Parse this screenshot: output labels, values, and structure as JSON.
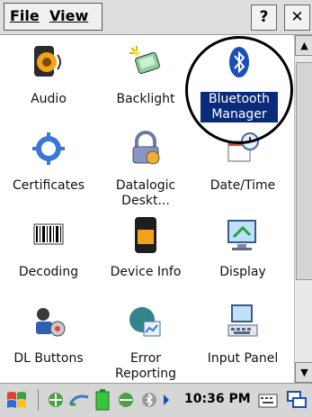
{
  "menubar": {
    "file_label": "File",
    "view_label": "View",
    "help_label": "?",
    "close_label": "✕"
  },
  "icons": [
    {
      "label": "Audio",
      "icon": "speaker-icon"
    },
    {
      "label": "Backlight",
      "icon": "backlight-icon"
    },
    {
      "label": "Bluetooth Manager",
      "icon": "bluetooth-icon",
      "selected": true
    },
    {
      "label": "Certificates",
      "icon": "certificate-icon"
    },
    {
      "label": "Datalogic Deskt...",
      "icon": "datalogic-desktop-icon"
    },
    {
      "label": "Date/Time",
      "icon": "calendar-clock-icon"
    },
    {
      "label": "Decoding",
      "icon": "barcode-icon"
    },
    {
      "label": "Device Info",
      "icon": "device-icon"
    },
    {
      "label": "Display",
      "icon": "display-icon"
    },
    {
      "label": "DL Buttons",
      "icon": "dl-buttons-icon"
    },
    {
      "label": "Error Reporting",
      "icon": "error-reporting-icon"
    },
    {
      "label": "Input Panel",
      "icon": "input-panel-icon"
    }
  ],
  "taskbar": {
    "clock": "10:36 PM"
  },
  "colors": {
    "selection": "#0a2b7a",
    "bluetooth_blue": "#1a4fb5"
  }
}
